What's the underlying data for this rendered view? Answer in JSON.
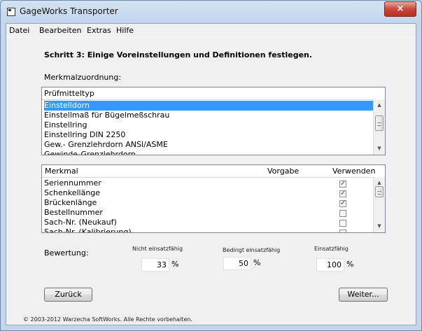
{
  "window": {
    "title": "GageWorks Transporter",
    "close_glyph": "×"
  },
  "menu": [
    "Datei",
    "Bearbeiten",
    "Extras",
    "Hilfe"
  ],
  "heading": "Schritt 3: Einige Voreinstellungen und Definitionen festlegen.",
  "assignment_label": "Merkmalzuordnung:",
  "gauge_list": {
    "header": "Prüfmitteltyp",
    "items": [
      "Einstelldorn",
      "Einstellmaß für Bügelmeßschrau",
      "Einstellring",
      "Einstellring DIN 2250",
      "Gew.- Grenzlehrdorn ANSI/ASME",
      "Gewinde-Grenzlehrdorn"
    ],
    "selected_index": 0
  },
  "feature_table": {
    "headers": {
      "feature": "Merkmal",
      "default": "Vorgabe",
      "use": "Verwenden"
    },
    "rows": [
      {
        "name": "Seriennummer",
        "checked": true
      },
      {
        "name": "Schenkellänge",
        "checked": true
      },
      {
        "name": "Brückenlänge",
        "checked": true
      },
      {
        "name": "Bestellnummer",
        "checked": false
      },
      {
        "name": "Sach-Nr. (Neukauf)",
        "checked": false
      },
      {
        "name": "Sach-Nr. (Kalibrierung)",
        "checked": false
      }
    ]
  },
  "rating": {
    "label": "Bewertung:",
    "fields": [
      {
        "caption": "Nicht einsatzfähig",
        "value": "33",
        "unit": "%"
      },
      {
        "caption": "Bedingt einsatzfähig",
        "value": "50",
        "unit": "%"
      },
      {
        "caption": "Einsatzfähig",
        "value": "100",
        "unit": "%"
      }
    ]
  },
  "buttons": {
    "back": "Zurück",
    "next": "Weiter..."
  },
  "footer": "© 2003-2012 Warzecha SoftWorks. Alle Rechte vorbehalten.",
  "colors": {
    "selection": "#3399ff",
    "window_frame": "#c3d6ec",
    "close_button": "#c8463a"
  }
}
